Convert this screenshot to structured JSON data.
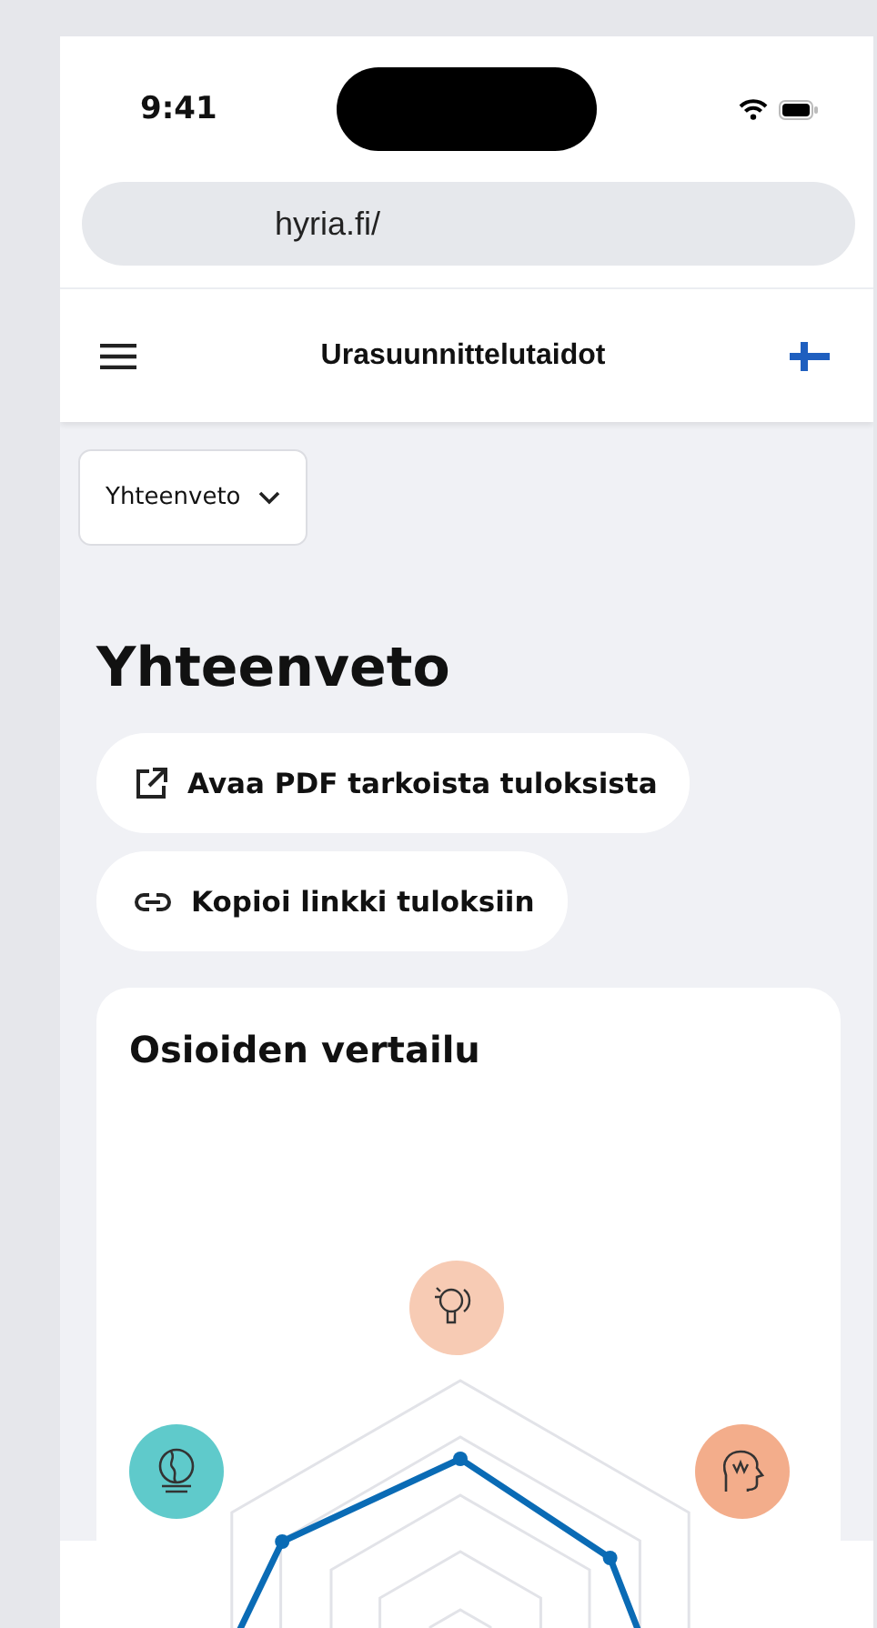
{
  "status_bar": {
    "time": "9:41"
  },
  "browser": {
    "url": "hyria.fi/"
  },
  "nav": {
    "title": "Urasuunnittelutaidot"
  },
  "section_select": {
    "value": "Yhteenveto"
  },
  "heading": "Yhteenveto",
  "actions": [
    {
      "kind": "external",
      "label": "Avaa PDF tarkoista tuloksista"
    },
    {
      "kind": "link",
      "label": "Kopioi linkki tuloksiin"
    }
  ],
  "comparison_card": {
    "title": "Osioiden vertailu",
    "axes": [
      {
        "kind": "idea",
        "color": "#f7cbb4"
      },
      {
        "kind": "head",
        "color": "#f3ad8b"
      },
      {
        "kind": "globe",
        "color": "#5fcacb"
      }
    ]
  }
}
